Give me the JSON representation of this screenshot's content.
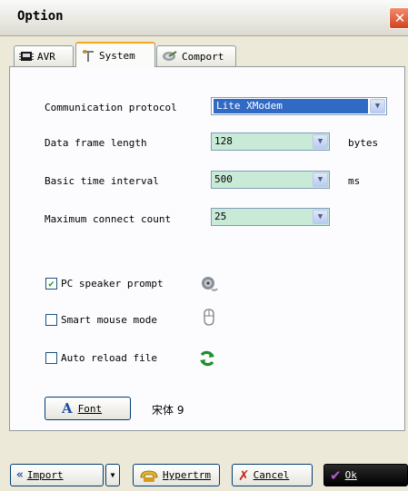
{
  "window": {
    "title": "Option",
    "close_symbol": "✕"
  },
  "tabs": [
    {
      "label": "AVR",
      "icon": "chip-icon",
      "active": false
    },
    {
      "label": "System",
      "icon": "tools-icon",
      "active": true
    },
    {
      "label": "Comport",
      "icon": "satellite-dish-icon",
      "active": false
    }
  ],
  "settings": {
    "protocol": {
      "label": "Communication protocol",
      "value": "Lite XModem"
    },
    "frame_length": {
      "label": "Data frame length",
      "value": "128",
      "unit": "bytes"
    },
    "time_interval": {
      "label": "Basic time interval",
      "value": "500",
      "unit": "ms"
    },
    "connect_count": {
      "label": "Maximum connect count",
      "value": "25"
    }
  },
  "options": {
    "pc_speaker": {
      "label": "PC speaker prompt",
      "checked": true,
      "icon": "speaker-icon",
      "check_mark": "✔"
    },
    "smart_mouse": {
      "label": "Smart mouse mode",
      "checked": false,
      "icon": "mouse-icon"
    },
    "auto_reload": {
      "label": "Auto reload file",
      "checked": false,
      "icon": "refresh-icon"
    }
  },
  "font": {
    "button_label": "Font",
    "button_letter": "A",
    "current": "宋体 9"
  },
  "toolbar": {
    "import_label": "Import",
    "hypertrm_label": "Hypertrm",
    "cancel_label": "Cancel",
    "ok_label": "Ok"
  },
  "colors": {
    "combo_bg": "#c8ead6",
    "selection": "#316ac5",
    "check_green": "#21a121",
    "cancel_red": "#c8241b"
  }
}
